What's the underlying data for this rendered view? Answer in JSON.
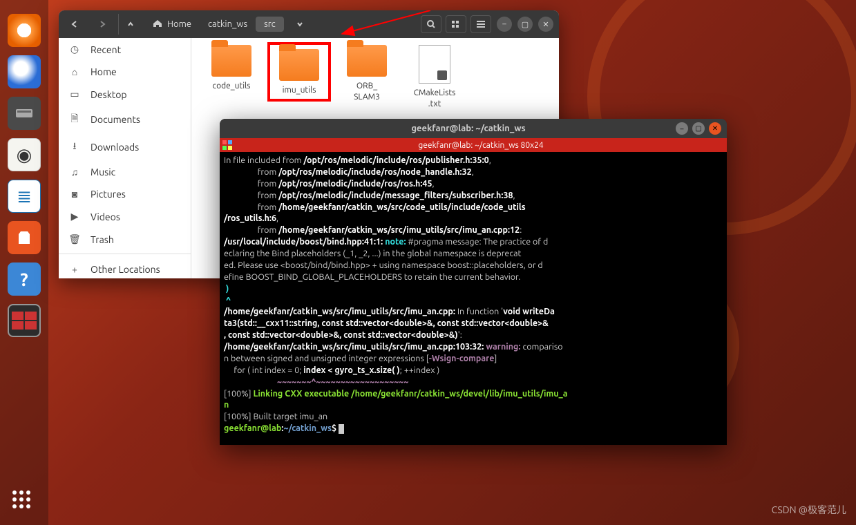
{
  "dock": {
    "items": [
      "firefox",
      "thunderbird",
      "files",
      "rhythmbox",
      "writer",
      "software",
      "help",
      "terminal"
    ]
  },
  "files_window": {
    "path": {
      "home_label": "Home",
      "seg1": "catkin_ws",
      "seg2": "src"
    },
    "sidebar": [
      {
        "icon": "clock",
        "label": "Recent"
      },
      {
        "icon": "home",
        "label": "Home"
      },
      {
        "icon": "desktop",
        "label": "Desktop"
      },
      {
        "icon": "docs",
        "label": "Documents"
      },
      {
        "icon": "down",
        "label": "Downloads"
      },
      {
        "icon": "music",
        "label": "Music"
      },
      {
        "icon": "pic",
        "label": "Pictures"
      },
      {
        "icon": "video",
        "label": "Videos"
      },
      {
        "icon": "trash",
        "label": "Trash"
      },
      {
        "icon": "plus",
        "label": "Other Locations"
      }
    ],
    "items": [
      {
        "type": "folder",
        "name": "code_utils",
        "hl": false
      },
      {
        "type": "folder",
        "name": "imu_utils",
        "hl": true
      },
      {
        "type": "folder",
        "name": "ORB_\nSLAM3",
        "hl": false
      },
      {
        "type": "text",
        "name": "CMakeLists\n.txt",
        "hl": false
      }
    ]
  },
  "terminal": {
    "title": "geekfanr@lab: ~/catkin_ws",
    "tab": "geekfanr@lab: ~/catkin_ws 80x24",
    "lines": {
      "l1a": "In file included from ",
      "l1b": "/opt/ros/melodic/include/ros/publisher.h:35:0",
      "l1c": ",",
      "l2a": "                 from ",
      "l2b": "/opt/ros/melodic/include/ros/node_handle.h:32",
      "l2c": ",",
      "l3a": "                 from ",
      "l3b": "/opt/ros/melodic/include/ros/ros.h:45",
      "l3c": ",",
      "l4a": "                 from ",
      "l4b": "/opt/ros/melodic/include/message_filters/subscriber.h:38",
      "l4c": ",",
      "l5a": "                 from ",
      "l5b": "/home/geekfanr/catkin_ws/src/code_utils/include/code_utils",
      "l6a": "/ros_utils.h:6",
      "l6b": ",",
      "l7a": "                 from ",
      "l7b": "/home/geekfanr/catkin_ws/src/imu_utils/src/imu_an.cpp:12",
      "l7c": ":",
      "l8a": "/usr/local/include/boost/bind.hpp:41:1:",
      "l8b": " note: ",
      "l8c": "#pragma message: The practice of d",
      "l9": "eclaring the Bind placeholders (_1, _2, ...) in the global namespace is deprecat",
      "l10": "ed. Please use <boost/bind/bind.hpp> + using namespace boost::placeholders, or d",
      "l11": "efine BOOST_BIND_GLOBAL_PLACEHOLDERS to retain the current behavior.",
      "l12": " )",
      "l13": " ^",
      "l14a": "/home/geekfanr/catkin_ws/src/imu_utils/src/imu_an.cpp:",
      "l14b": " In function '",
      "l14c": "void writeDa",
      "l15": "ta3(std::__cxx11::string, const std::vector<double>&, const std::vector<double>&",
      "l16": ", const std::vector<double>&, const std::vector<double>&)",
      "l16b": "':",
      "l17a": "/home/geekfanr/catkin_ws/src/imu_utils/src/imu_an.cpp:103:32:",
      "l17b": " warning: ",
      "l17c": "compariso",
      "l18a": "n between signed and unsigned integer expressions [",
      "l18b": "-Wsign-compare",
      "l18c": "]",
      "l19a": "     for ( int index = 0; ",
      "l19b": "index < gyro_ts_x.size( )",
      "l19c": "; ++index )",
      "l20": "                          ~~~~~~~^~~~~~~~~~~~~~~~~~~~",
      "l21a": "[100%] ",
      "l21b": "Linking CXX executable /home/geekfanr/catkin_ws/devel/lib/imu_utils/imu_a",
      "l22": "n",
      "l23": "[100%] Built target imu_an",
      "p_user": "geekfanr@lab",
      "p_colon": ":",
      "p_path": "~/catkin_ws",
      "p_dollar": "$ "
    }
  },
  "watermark": "CSDN @极客范儿"
}
